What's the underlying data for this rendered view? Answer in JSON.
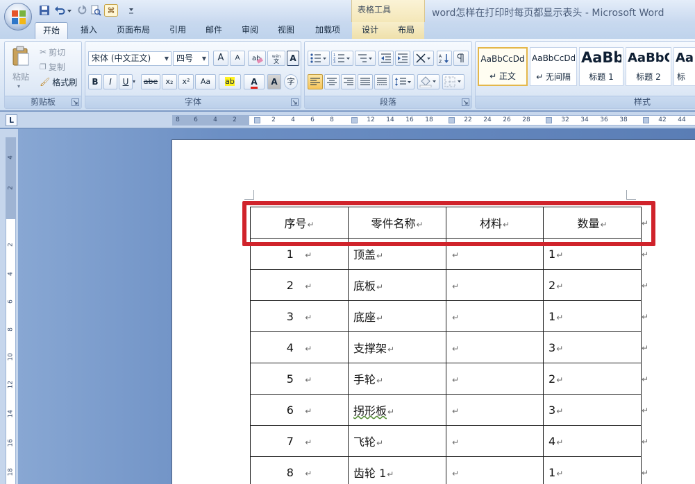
{
  "titlebar": {
    "context_tab": "表格工具",
    "window_title": "word怎样在打印时每页都显示表头 - Microsoft Word"
  },
  "tabs": [
    {
      "label": "开始",
      "active": true
    },
    {
      "label": "插入"
    },
    {
      "label": "页面布局"
    },
    {
      "label": "引用"
    },
    {
      "label": "邮件"
    },
    {
      "label": "审阅"
    },
    {
      "label": "视图"
    },
    {
      "label": "加载项"
    },
    {
      "label": "设计",
      "contextual": true
    },
    {
      "label": "布局",
      "contextual": true
    }
  ],
  "clipboard": {
    "paste": "粘贴",
    "cut": "剪切",
    "copy": "复制",
    "format_painter": "格式刷",
    "group_label": "剪贴板"
  },
  "font": {
    "font_name": "宋体 (中文正文)",
    "font_size": "四号",
    "group_label": "字体",
    "grow": "A",
    "shrink": "A",
    "bold": "B",
    "italic": "I",
    "underline": "U",
    "strike": "abe",
    "subscript": "x₂",
    "superscript": "x²",
    "change_case": "Aa",
    "highlight": "ab",
    "font_color": "A",
    "char_shading": "A",
    "enclose": "字"
  },
  "paragraph": {
    "group_label": "段落"
  },
  "styles": {
    "group_label": "样式",
    "items": [
      {
        "sample": "AaBbCcDd",
        "name": "↵ 正文",
        "selected": true
      },
      {
        "sample": "AaBbCcDd",
        "name": "↵ 无间隔"
      },
      {
        "sample": "AaBb",
        "name": "标题 1"
      },
      {
        "sample": "AaBbC",
        "name": "标题 2"
      },
      {
        "sample": "Aa",
        "name": "标"
      }
    ]
  },
  "ruler": {
    "tab_selector": "L",
    "h_ticks": [
      "8",
      "6",
      "4",
      "2",
      "2",
      "4",
      "6",
      "8",
      "12",
      "14",
      "16",
      "18",
      "22",
      "24",
      "26",
      "28",
      "32",
      "34",
      "36",
      "38",
      "42",
      "44"
    ],
    "v_ticks": [
      "4",
      "2",
      "2",
      "4",
      "6",
      "8",
      "10",
      "12",
      "14",
      "16",
      "18"
    ]
  },
  "table": {
    "headers": [
      "序号",
      "零件名称",
      "材料",
      "数量"
    ],
    "rows": [
      {
        "num": "1",
        "name": "顶盖",
        "material": "",
        "qty": "1"
      },
      {
        "num": "2",
        "name": "底板",
        "material": "",
        "qty": "2"
      },
      {
        "num": "3",
        "name": "底座",
        "material": "",
        "qty": "1"
      },
      {
        "num": "4",
        "name": "支撑架",
        "material": "",
        "qty": "3"
      },
      {
        "num": "5",
        "name": "手轮",
        "material": "",
        "qty": "2"
      },
      {
        "num": "6",
        "name": "拐形板",
        "material": "",
        "qty": "3"
      },
      {
        "num": "7",
        "name": "飞轮",
        "material": "",
        "qty": "4"
      },
      {
        "num": "8",
        "name": "齿轮 1",
        "material": "",
        "qty": "1"
      }
    ],
    "cell_mark": "↵"
  },
  "colors": {
    "highlight_box": "#d0232b",
    "ribbon_bg": "#dde8f6",
    "workspace_bg": "#6c8fc4"
  }
}
